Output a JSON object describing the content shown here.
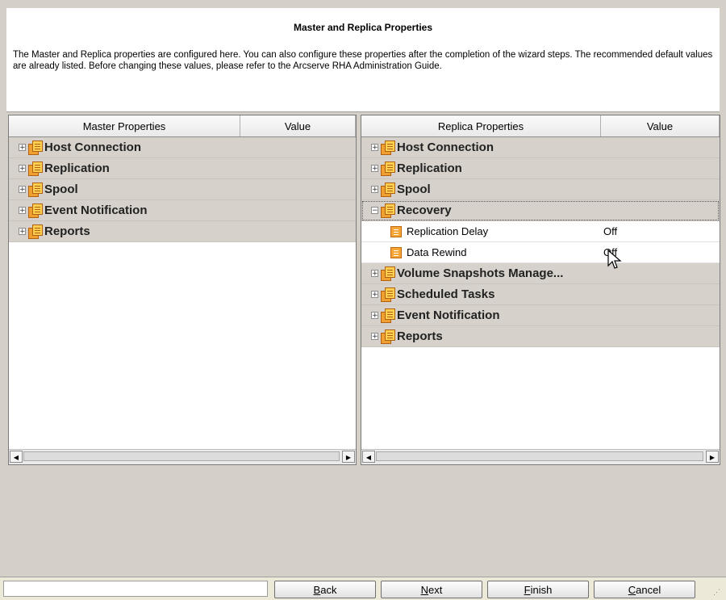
{
  "header": {
    "title": "Master and Replica Properties",
    "description": "The Master and Replica properties are configured here. You can also configure these properties after the completion of the wizard steps. The recommended default values are already listed. Before changing these values, please refer to the Arcserve RHA Administration Guide."
  },
  "master": {
    "col_property": "Master Properties",
    "col_value": "Value",
    "groups": [
      {
        "label": "Host Connection"
      },
      {
        "label": "Replication"
      },
      {
        "label": "Spool"
      },
      {
        "label": "Event Notification"
      },
      {
        "label": "Reports"
      }
    ]
  },
  "replica": {
    "col_property": "Replica Properties",
    "col_value": "Value",
    "groups": [
      {
        "label": "Host Connection"
      },
      {
        "label": "Replication"
      },
      {
        "label": "Spool"
      },
      {
        "label": "Recovery",
        "expanded": true,
        "children": [
          {
            "label": "Replication Delay",
            "value": "Off"
          },
          {
            "label": "Data Rewind",
            "value": "Off"
          }
        ]
      },
      {
        "label": "Volume Snapshots Manage..."
      },
      {
        "label": "Scheduled Tasks"
      },
      {
        "label": "Event Notification"
      },
      {
        "label": "Reports"
      }
    ]
  },
  "buttons": {
    "back": {
      "mnemonic": "B",
      "rest": "ack"
    },
    "next": {
      "mnemonic": "N",
      "rest": "ext"
    },
    "finish": {
      "mnemonic": "F",
      "rest": "inish"
    },
    "cancel": {
      "mnemonic": "C",
      "rest": "ancel"
    }
  },
  "icons": {
    "expand": "plus-box-icon",
    "collapse": "minus-box-icon",
    "group": "property-group-icon",
    "property": "property-sheet-icon"
  },
  "colors": {
    "group_row_bg": "#d6d2cb",
    "frame_bg": "#d4d0c8"
  }
}
